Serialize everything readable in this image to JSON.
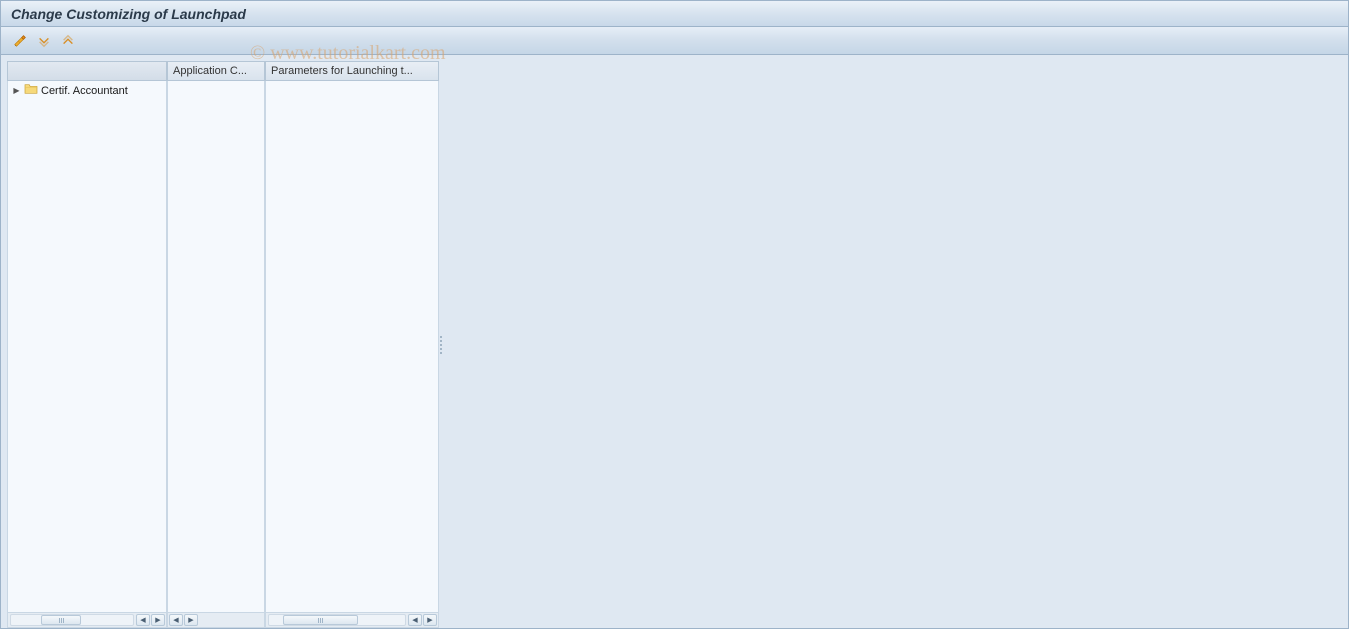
{
  "window": {
    "title": "Change Customizing of Launchpad"
  },
  "toolbar": {
    "icons": {
      "toggle": "toggle-icon",
      "expand": "expand-icon",
      "collapse": "collapse-icon"
    }
  },
  "columns": {
    "tree_header": "",
    "app_header": "Application C...",
    "param_header": "Parameters for Launching t..."
  },
  "tree": {
    "items": [
      {
        "label": "Certif. Accountant",
        "icon": "folder-icon",
        "expandable": true
      }
    ]
  },
  "watermark": "© www.tutorialkart.com"
}
